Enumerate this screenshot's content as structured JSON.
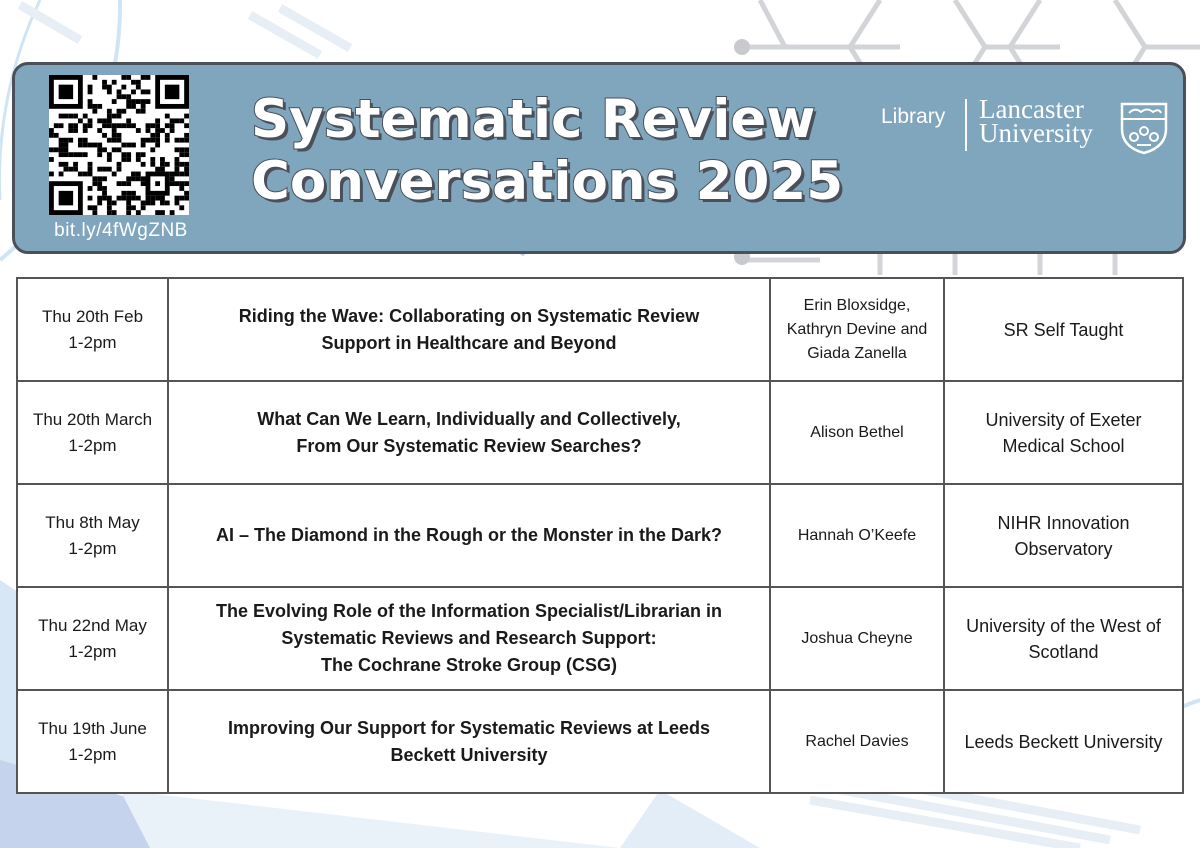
{
  "header": {
    "title_line1": "Systematic Review",
    "title_line2": "Conversations 2025",
    "short_url": "bit.ly/4fWgZNB",
    "library_label": "Library",
    "university_line1": "Lancaster",
    "university_line2": "University"
  },
  "sessions": [
    {
      "date": "Thu 20th Feb",
      "time": "1-2pm",
      "title_lines": [
        "Riding the Wave: Collaborating on Systematic Review",
        "Support in Healthcare and Beyond"
      ],
      "speaker_lines": [
        "Erin Bloxsidge,",
        "Kathryn Devine and",
        "Giada Zanella"
      ],
      "org_lines": [
        "SR Self Taught"
      ]
    },
    {
      "date": "Thu 20th March",
      "time": "1-2pm",
      "title_lines": [
        "What Can We Learn, Individually and Collectively,",
        "From Our Systematic Review Searches?"
      ],
      "speaker_lines": [
        "Alison Bethel"
      ],
      "org_lines": [
        "University of Exeter",
        "Medical School"
      ]
    },
    {
      "date": "Thu 8th May",
      "time": "1-2pm",
      "title_lines": [
        "AI – The Diamond in the Rough or the Monster in the Dark?"
      ],
      "speaker_lines": [
        "Hannah O’Keefe"
      ],
      "org_lines": [
        "NIHR Innovation",
        "Observatory"
      ]
    },
    {
      "date": "Thu 22nd May",
      "time": "1-2pm",
      "title_lines": [
        "The Evolving Role of the Information Specialist/Librarian in",
        "Systematic Reviews and Research Support:",
        "The Cochrane Stroke Group (CSG)"
      ],
      "speaker_lines": [
        "Joshua Cheyne"
      ],
      "org_lines": [
        "University of the West of",
        "Scotland"
      ]
    },
    {
      "date": "Thu 19th June",
      "time": "1-2pm",
      "title_lines": [
        "Improving Our Support for Systematic Reviews at Leeds",
        "Beckett University"
      ],
      "speaker_lines": [
        "Rachel Davies"
      ],
      "org_lines": [
        "Leeds Beckett University"
      ]
    }
  ],
  "colors": {
    "banner": "#7fa6bc",
    "banner_border": "#4b4f57",
    "accent_light_blue": "#bcd8ef",
    "text": "#1a1a1a"
  },
  "icons": [
    "qr-code-icon",
    "university-crest-icon"
  ]
}
